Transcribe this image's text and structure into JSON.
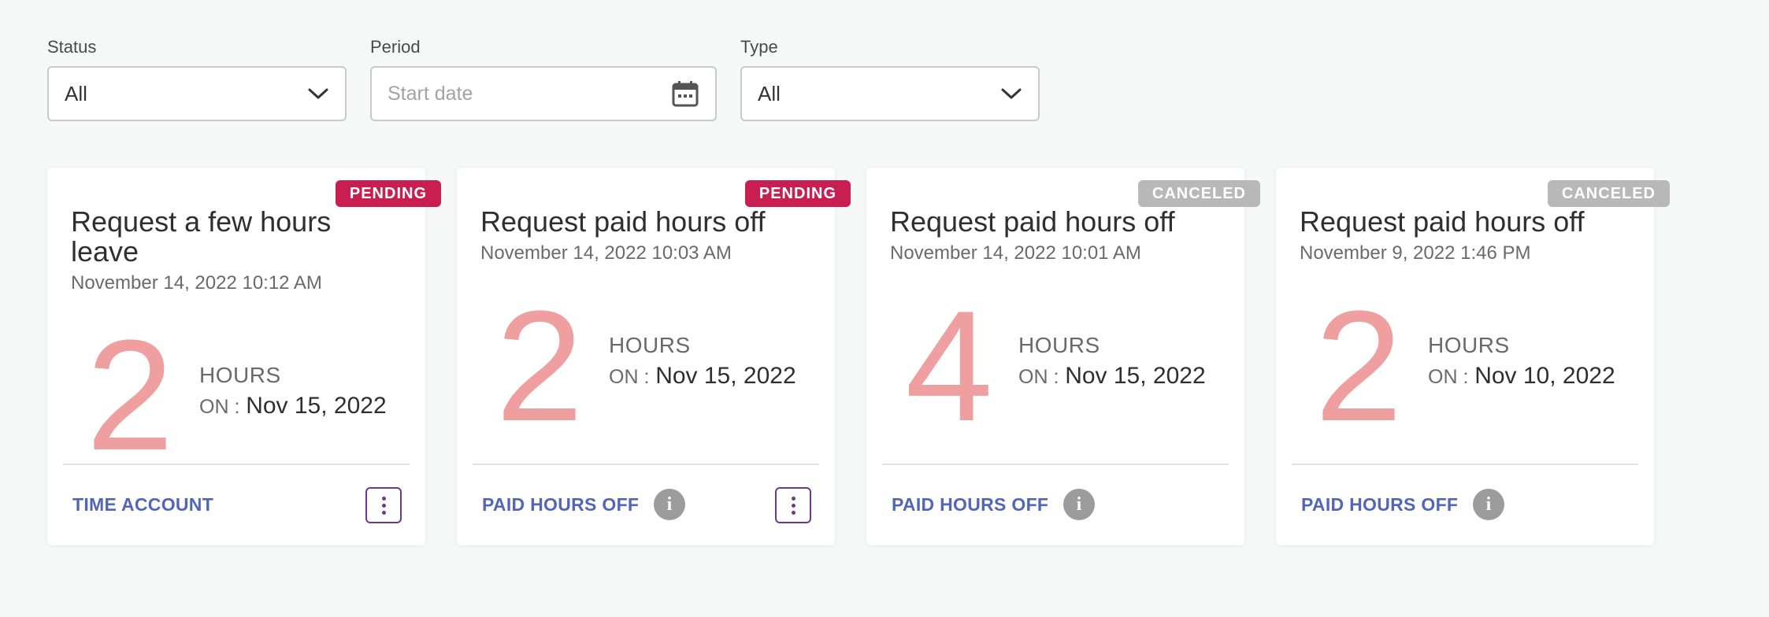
{
  "filters": {
    "status": {
      "label": "Status",
      "value": "All"
    },
    "period": {
      "label": "Period",
      "placeholder": "Start date"
    },
    "type": {
      "label": "Type",
      "value": "All"
    }
  },
  "cards": [
    {
      "badge": "PENDING",
      "title": "Request a few hours leave",
      "date": "November 14, 2022 10:12 AM",
      "amount": "2",
      "unit": "HOURS",
      "on_label": "ON :",
      "on_date": "Nov 15, 2022",
      "type": "TIME ACCOUNT"
    },
    {
      "badge": "PENDING",
      "title": "Request paid hours off",
      "date": "November 14, 2022 10:03 AM",
      "amount": "2",
      "unit": "HOURS",
      "on_label": "ON :",
      "on_date": "Nov 15, 2022",
      "type": "PAID HOURS OFF"
    },
    {
      "badge": "CANCELED",
      "title": "Request paid hours off",
      "date": "November 14, 2022 10:01 AM",
      "amount": "4",
      "unit": "HOURS",
      "on_label": "ON :",
      "on_date": "Nov 15, 2022",
      "type": "PAID HOURS OFF"
    },
    {
      "badge": "CANCELED",
      "title": "Request paid hours off",
      "date": "November 9, 2022 1:46 PM",
      "amount": "2",
      "unit": "HOURS",
      "on_label": "ON :",
      "on_date": "Nov 10, 2022",
      "type": "PAID HOURS OFF"
    }
  ],
  "info_icon_glyph": "i",
  "colors": {
    "pending": "#c81e52",
    "canceled": "#b8b8b8",
    "big_number": "#ef9f9f",
    "type_link": "#5166b8",
    "menu_border": "#6b3a8c"
  }
}
